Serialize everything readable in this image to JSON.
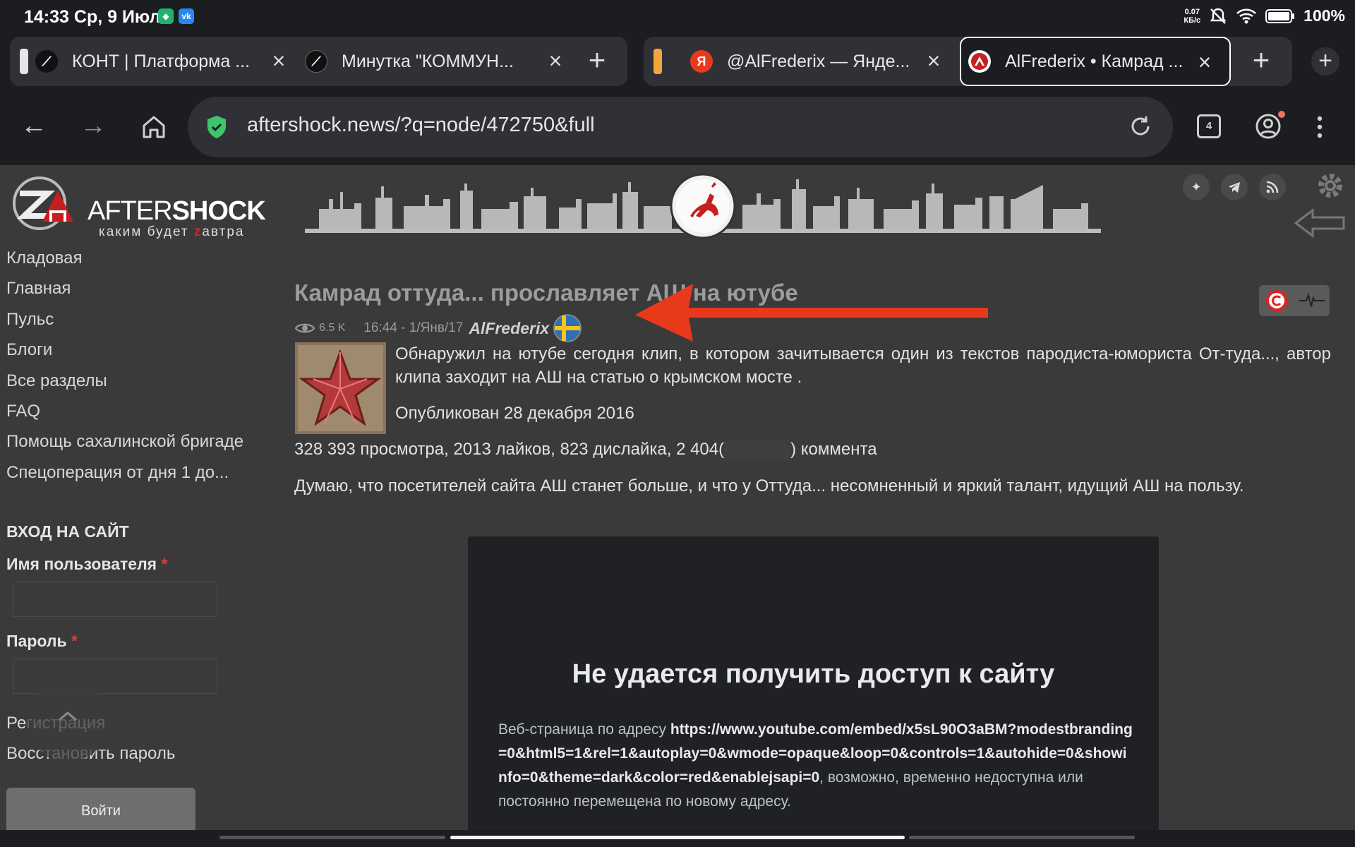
{
  "status": {
    "time": "14:33 Ср, 9 Июл",
    "speed_value": "0.07",
    "speed_unit": "КБ/с",
    "battery": "100%"
  },
  "tabs": [
    {
      "title": "КОНТ | Платформа ..."
    },
    {
      "title": "Минутка \"КОММУН..."
    },
    {
      "title": "@AlFrederix — Янде..."
    },
    {
      "title": "AlFrederix • Камрад ..."
    }
  ],
  "yandex_favicon": "Я",
  "address": {
    "url": "aftershock.news/?q=node/472750&full",
    "tab_count": "4"
  },
  "site": {
    "logo_a": "AFTER",
    "logo_b": "SHOCK",
    "tagline_1": "каким будет ",
    "tagline_z": "z",
    "tagline_2": "автра"
  },
  "nav": [
    "Кладовая",
    "Главная",
    "Пульс",
    "Блоги",
    "Все разделы",
    "FAQ",
    "Помощь сахалинской бригаде",
    "Спецоперация от дня 1 до..."
  ],
  "login": {
    "heading": "ВХОД НА САЙТ",
    "username_label": "Имя пользователя",
    "password_label": "Пароль",
    "required_mark": "*",
    "register": "Регистрация",
    "restore": "Восстановить пароль",
    "submit": "Войти"
  },
  "article": {
    "title": "Камрад оттуда... прославляет АШ на ютубе",
    "views": "6.5 K",
    "date": "16:44 - 1/Янв/17",
    "author": "AlFrederix",
    "p1": "Обнаружил на ютубе сегодня клип, в котором зачитывается один из текстов пародиста-юмориста От-туда..., автор клипа заходит на АШ на статью о крымском мосте .",
    "p2": "Опубликован 28 декабря 2016",
    "p3_a": "328 393 просмотра, 2013 лайков, 823 дислайка, 2 404(",
    "p3_b": ") коммента",
    "p4": "Думаю, что посетителей сайта АШ станет больше, и что у Оттуда... несомненный и яркий талант, идущий АШ на пользу."
  },
  "embed": {
    "heading": "Не удается получить доступ к сайту",
    "text_a": "Веб-страница по адресу ",
    "url": "https://www.youtube.com/embed/x5sL90O3aBM?modestbranding=0&html5=1&rel=1&autoplay=0&wmode=opaque&loop=0&controls=1&autohide=0&showinfo=0&theme=dark&color=red&enablejsapi=0",
    "text_b": ", возможно, временно недоступна или постоянно перемещена по новому адресу."
  },
  "colors": {
    "accent_red": "#e8391b",
    "page_bg": "#3a3a3a",
    "chrome_bg": "#1c1d21",
    "tab_bg": "#2f3136"
  }
}
